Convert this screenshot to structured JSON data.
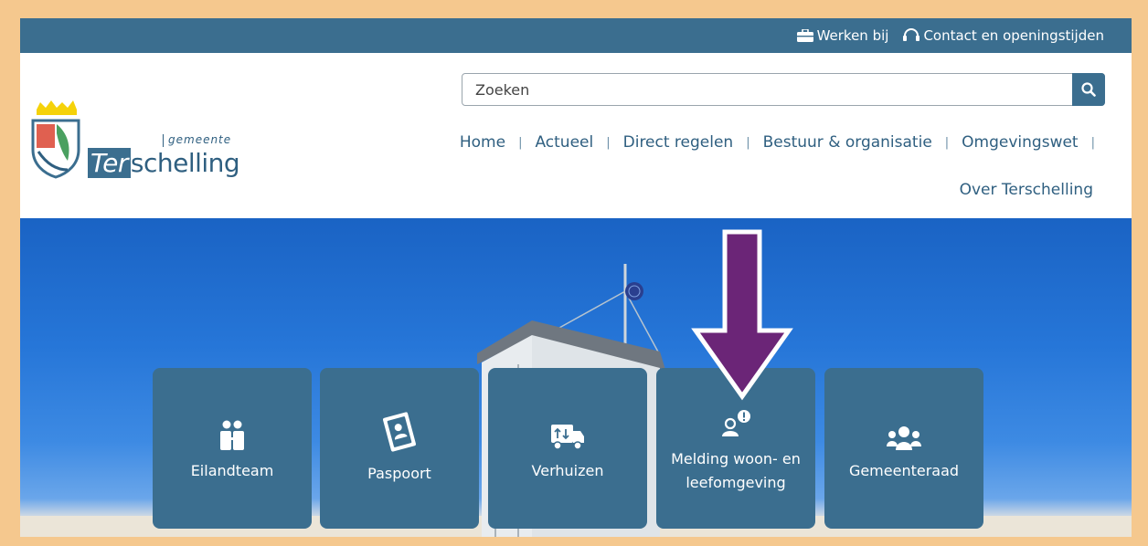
{
  "topbar": {
    "links": [
      {
        "label": "Werken bij",
        "icon": "briefcase-icon"
      },
      {
        "label": "Contact en openingstijden",
        "icon": "headset-icon"
      }
    ]
  },
  "logo": {
    "small_text": "gemeente",
    "name_part1": "Ter",
    "name_part2": "schelling"
  },
  "search": {
    "placeholder": "Zoeken",
    "value": ""
  },
  "nav": {
    "items": [
      "Home",
      "Actueel",
      "Direct regelen",
      "Bestuur & organisatie",
      "Omgevingswet"
    ],
    "second_row": "Over Terschelling"
  },
  "tiles": [
    {
      "label": "Eilandteam",
      "icon": "people-icon"
    },
    {
      "label": "Paspoort",
      "icon": "passport-icon"
    },
    {
      "label": "Verhuizen",
      "icon": "moving-truck-icon"
    },
    {
      "label": "Melding woon- en leefomgeving",
      "icon": "report-icon"
    },
    {
      "label": "Gemeenteraad",
      "icon": "council-icon"
    }
  ],
  "colors": {
    "brand": "#3b6e8f",
    "frame": "#f5c88e",
    "annotation_arrow": "#6b2577"
  }
}
